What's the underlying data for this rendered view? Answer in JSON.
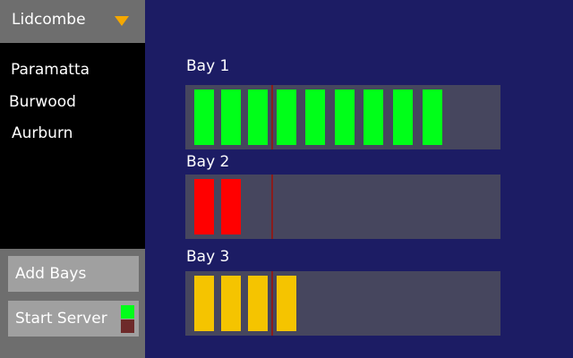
{
  "location_dropdown": {
    "selected": "Lidcombe"
  },
  "locations": [
    {
      "label": "Paramatta"
    },
    {
      "label": "Burwood"
    },
    {
      "label": "Aurburn"
    }
  ],
  "buttons": {
    "add_bays": "Add Bays",
    "start_server": "Start Server"
  },
  "server_status": {
    "on_color": "#00ff19",
    "off_color": "#6e2a2a"
  },
  "bays": [
    {
      "label": "Bay 1",
      "occupied": 9,
      "color": "#00ff19"
    },
    {
      "label": "Bay 2",
      "occupied": 2,
      "color": "#ff0000"
    },
    {
      "label": "Bay 3",
      "occupied": 4,
      "color": "#f5c400"
    }
  ],
  "colors": {
    "background": "#1c1c64",
    "bay_track": "#46465e",
    "divider": "#8a1c1c",
    "dropdown_arrow": "#f5a800"
  }
}
